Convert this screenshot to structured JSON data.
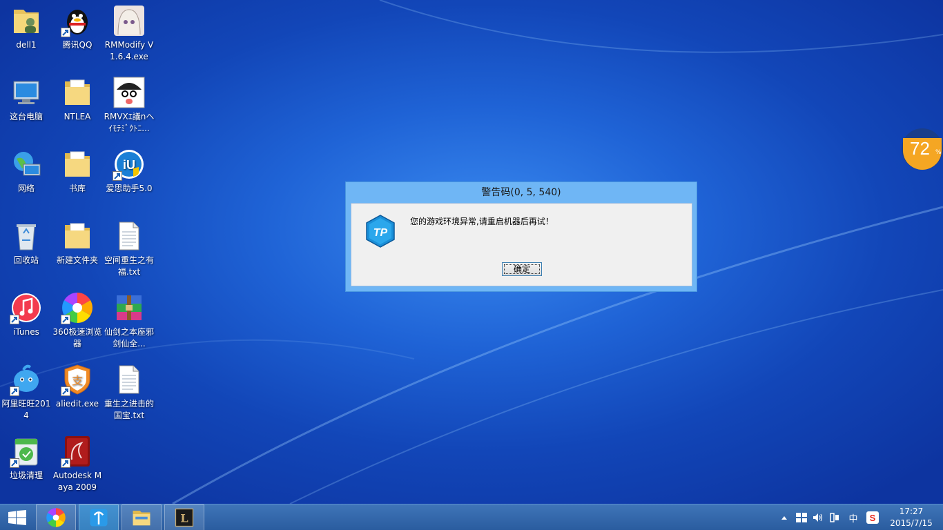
{
  "desktop_icons": [
    {
      "label": "dell1"
    },
    {
      "label": "腾讯QQ"
    },
    {
      "label": "RMModify V1.6.4.exe"
    },
    {
      "label": "这台电脑"
    },
    {
      "label": "NTLEA"
    },
    {
      "label": "RMVXｴ議nヘｲﾓﾃﾐﾞｸﾄﾆ..."
    },
    {
      "label": "网络"
    },
    {
      "label": "书库"
    },
    {
      "label": "爱思助手5.0"
    },
    {
      "label": "回收站"
    },
    {
      "label": "新建文件夹"
    },
    {
      "label": "空间重生之有福.txt"
    },
    {
      "label": "iTunes"
    },
    {
      "label": "360极速浏览器"
    },
    {
      "label": "仙剑之本座邪剑仙全..."
    },
    {
      "label": "阿里旺旺2014"
    },
    {
      "label": "aliedit.exe"
    },
    {
      "label": "重生之进击的国宝.txt"
    },
    {
      "label": "垃圾清理"
    },
    {
      "label": "Autodesk Maya 2009"
    }
  ],
  "dialog": {
    "title": "警告码(0, 5, 540)",
    "message": "您的游戏环境异常,请重启机器后再试！",
    "ok_label": "确定",
    "logo_text": "TP"
  },
  "battery_widget": {
    "value": "72",
    "unit": "%"
  },
  "taskbar": {
    "start_icon": "windows-logo-icon",
    "apps": [
      "360-browser-icon",
      "aisi-helper-icon",
      "file-explorer-icon",
      "league-of-legends-icon"
    ],
    "lol_text": "L"
  },
  "tray": {
    "ime": "中",
    "sogou": "S",
    "time": "17:27",
    "date": "2015/7/15"
  },
  "colors": {
    "accent": "#2a5c9f",
    "dialog_frame": "#6fb6f5",
    "battery": "#f5a623"
  }
}
